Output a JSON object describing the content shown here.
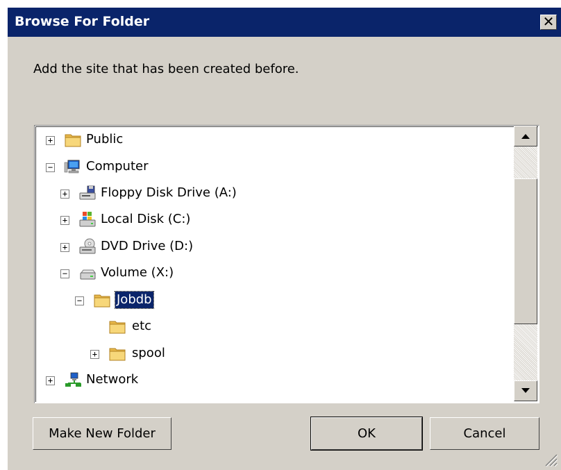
{
  "window": {
    "title": "Browse For Folder",
    "close_label": "✕"
  },
  "instruction": "Add the site that has been created before.",
  "tree": {
    "items": [
      {
        "label": "Public",
        "expander": "+",
        "icon": "folder-icon"
      },
      {
        "label": "Computer",
        "expander": "−",
        "icon": "computer-icon"
      },
      {
        "label": "Floppy Disk Drive (A:)",
        "expander": "+",
        "icon": "floppy-drive-icon"
      },
      {
        "label": "Local Disk (C:)",
        "expander": "+",
        "icon": "local-disk-icon"
      },
      {
        "label": "DVD Drive (D:)",
        "expander": "+",
        "icon": "dvd-drive-icon"
      },
      {
        "label": "Volume (X:)",
        "expander": "−",
        "icon": "volume-drive-icon"
      },
      {
        "label": "Jobdb",
        "expander": "−",
        "icon": "folder-icon",
        "selected": true
      },
      {
        "label": "etc",
        "expander": "",
        "icon": "folder-icon"
      },
      {
        "label": "spool",
        "expander": "+",
        "icon": "folder-icon"
      },
      {
        "label": "Network",
        "expander": "+",
        "icon": "network-icon"
      }
    ]
  },
  "buttons": {
    "make_new_folder": "Make New Folder",
    "ok": "OK",
    "cancel": "Cancel"
  },
  "colors": {
    "titlebar": "#0a246a",
    "dialog_bg": "#d4d0c8",
    "selection": "#0a246a",
    "folder": "#f2c55c"
  }
}
